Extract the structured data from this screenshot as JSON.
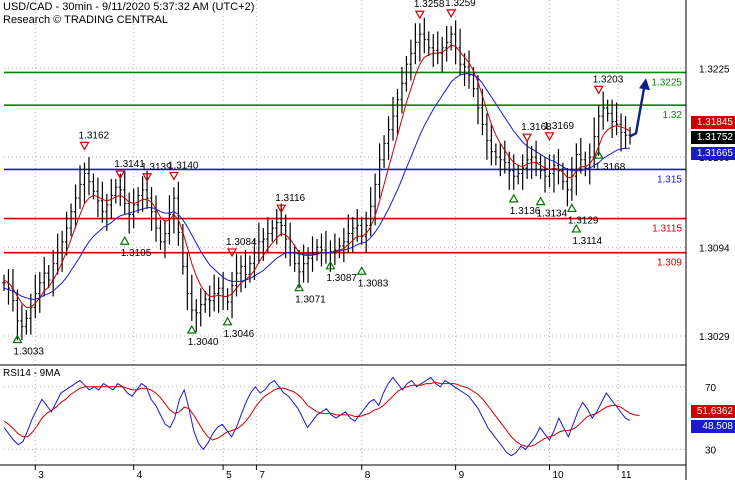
{
  "header": {
    "title": "USD/CAD - 30min - 9/11/2020 5:37:32 AM (UTC+2)",
    "source": "Research © TRADING CENTRAL"
  },
  "rsi_title": "RSI14 - 9MA",
  "colors": {
    "price_bar": "#000000",
    "ma_fast": "#cc0000",
    "ma_slow": "#1a1acc",
    "support": "#cc0000",
    "resistance_green": "#008800",
    "pivot": "#1a1acc",
    "forecast_arrow": "#0a1f8a",
    "up_marker": "#007700",
    "down_marker": "#cc0000",
    "grid": "#b0b0b0"
  },
  "chart_data": [
    {
      "type": "line",
      "title": "USD/CAD - 30min - 9/11/2020 5:37:32 AM (UTC+2)",
      "y_ticks": [
        "1.3225",
        "1.3160",
        "1.3094",
        "1.3029"
      ],
      "ylim": [
        1.301,
        1.3275
      ],
      "x_ticks": [
        "3",
        "4",
        "5",
        "7",
        "8",
        "9",
        "10",
        "11"
      ],
      "levels": [
        {
          "label": "1.3225",
          "value": 1.3222,
          "color": "resistance_green"
        },
        {
          "label": "1.32",
          "value": 1.3198,
          "color": "resistance_green"
        },
        {
          "label": "1.315",
          "value": 1.3151,
          "color": "pivot"
        },
        {
          "label": "1.3115",
          "value": 1.3115,
          "color": "support"
        },
        {
          "label": "1.309",
          "value": 1.309,
          "color": "support"
        }
      ],
      "current_prices": [
        {
          "label": "1.31845",
          "value": 1.31845,
          "color": "#cc0000"
        },
        {
          "label": "1.31752",
          "value": 1.31752,
          "color": "#000000"
        },
        {
          "label": "1.31665",
          "value": 1.31665,
          "color": "#1a1acc"
        }
      ],
      "annotations": [
        {
          "label": "1.3033",
          "value": 1.3033,
          "dir": "low",
          "idx": 3
        },
        {
          "label": "1.3162",
          "value": 1.3162,
          "dir": "high",
          "idx": 18
        },
        {
          "label": "1.3141",
          "value": 1.3141,
          "dir": "high",
          "idx": 26
        },
        {
          "label": "1.3105",
          "value": 1.3105,
          "dir": "low",
          "idx": 27
        },
        {
          "label": "1.3139",
          "value": 1.3139,
          "dir": "high",
          "idx": 32
        },
        {
          "label": "1.3140",
          "value": 1.314,
          "dir": "high",
          "idx": 38
        },
        {
          "label": "1.3040",
          "value": 1.304,
          "dir": "low",
          "idx": 42
        },
        {
          "label": "1.3046",
          "value": 1.3046,
          "dir": "low",
          "idx": 50
        },
        {
          "label": "1.3084",
          "value": 1.3084,
          "dir": "high",
          "idx": 51
        },
        {
          "label": "1.3116",
          "value": 1.3116,
          "dir": "high",
          "idx": 62
        },
        {
          "label": "1.3071",
          "value": 1.3071,
          "dir": "low",
          "idx": 66
        },
        {
          "label": "1.3087",
          "value": 1.3087,
          "dir": "low",
          "idx": 73
        },
        {
          "label": "1.3083",
          "value": 1.3083,
          "dir": "low",
          "idx": 80
        },
        {
          "label": "1.3258",
          "value": 1.3258,
          "dir": "high",
          "idx": 93
        },
        {
          "label": "1.3259",
          "value": 1.3259,
          "dir": "high",
          "idx": 100
        },
        {
          "label": "1.3136",
          "value": 1.3136,
          "dir": "low",
          "idx": 114
        },
        {
          "label": "1.3168",
          "value": 1.3168,
          "dir": "high",
          "idx": 117
        },
        {
          "label": "1.3134",
          "value": 1.3134,
          "dir": "low",
          "idx": 120
        },
        {
          "label": "1.3169",
          "value": 1.3169,
          "dir": "high",
          "idx": 122
        },
        {
          "label": "1.3129",
          "value": 1.3129,
          "dir": "low",
          "idx": 127
        },
        {
          "label": "1.3114",
          "value": 1.3114,
          "dir": "low",
          "idx": 128
        },
        {
          "label": "1.3168",
          "value": 1.3168,
          "dir": "low",
          "idx": 133
        },
        {
          "label": "1.3203",
          "value": 1.3203,
          "dir": "high",
          "idx": 133
        }
      ],
      "series": [
        {
          "name": "USD/CAD",
          "values": [
            1.3068,
            1.3064,
            1.3055,
            1.304,
            1.3036,
            1.3042,
            1.305,
            1.306,
            1.3068,
            1.3075,
            1.307,
            1.3082,
            1.309,
            1.3098,
            1.3108,
            1.312,
            1.313,
            1.314,
            1.3148,
            1.3142,
            1.3135,
            1.3128,
            1.312,
            1.3125,
            1.3132,
            1.3138,
            1.3136,
            1.3126,
            1.3118,
            1.3125,
            1.3132,
            1.3136,
            1.313,
            1.312,
            1.3108,
            1.3098,
            1.3104,
            1.3118,
            1.313,
            1.3105,
            1.308,
            1.306,
            1.3048,
            1.3046,
            1.3052,
            1.3056,
            1.3055,
            1.306,
            1.3064,
            1.3058,
            1.3054,
            1.3066,
            1.3075,
            1.308,
            1.3074,
            1.3082,
            1.309,
            1.3098,
            1.31,
            1.3104,
            1.3108,
            1.3112,
            1.311,
            1.31,
            1.309,
            1.3082,
            1.3076,
            1.3082,
            1.3086,
            1.309,
            1.3094,
            1.3092,
            1.309,
            1.3091,
            1.3092,
            1.3095,
            1.3098,
            1.3104,
            1.3108,
            1.311,
            1.3102,
            1.311,
            1.3124,
            1.314,
            1.3158,
            1.317,
            1.318,
            1.319,
            1.3202,
            1.3214,
            1.3228,
            1.3236,
            1.3244,
            1.325,
            1.3246,
            1.324,
            1.3238,
            1.3236,
            1.324,
            1.3244,
            1.325,
            1.324,
            1.3228,
            1.3226,
            1.322,
            1.321,
            1.3196,
            1.3184,
            1.3172,
            1.3164,
            1.316,
            1.3158,
            1.3156,
            1.315,
            1.3146,
            1.3148,
            1.3152,
            1.3158,
            1.316,
            1.3156,
            1.315,
            1.3146,
            1.3148,
            1.3154,
            1.315,
            1.3142,
            1.3136,
            1.3146,
            1.3162,
            1.3158,
            1.3152,
            1.316,
            1.3175,
            1.319,
            1.3196,
            1.3192,
            1.3186,
            1.3184,
            1.3178,
            1.3176,
            1.31752
          ]
        },
        {
          "name": "MA fast",
          "values": [
            1.307,
            1.3068,
            1.3064,
            1.3058,
            1.3053,
            1.305,
            1.305,
            1.3053,
            1.3057,
            1.3062,
            1.3065,
            1.307,
            1.3076,
            1.3083,
            1.3091,
            1.31,
            1.3109,
            1.3118,
            1.3126,
            1.313,
            1.3132,
            1.3131,
            1.3129,
            1.3128,
            1.3129,
            1.3131,
            1.3132,
            1.313,
            1.3127,
            1.3126,
            1.3127,
            1.3129,
            1.3129,
            1.3127,
            1.3122,
            1.3116,
            1.3113,
            1.3114,
            1.3118,
            1.3114,
            1.3105,
            1.3094,
            1.3082,
            1.3073,
            1.3066,
            1.3061,
            1.3058,
            1.3058,
            1.3059,
            1.3058,
            1.3058,
            1.306,
            1.3064,
            1.3068,
            1.307,
            1.3073,
            1.3077,
            1.3083,
            1.3088,
            1.3093,
            1.3097,
            1.3101,
            1.3104,
            1.3103,
            1.31,
            1.3095,
            1.309,
            1.3088,
            1.3088,
            1.3088,
            1.3089,
            1.309,
            1.309,
            1.309,
            1.3091,
            1.3092,
            1.3093,
            1.3096,
            1.3099,
            1.3102,
            1.3102,
            1.3104,
            1.3109,
            1.3117,
            1.3128,
            1.314,
            1.3152,
            1.3164,
            1.3176,
            1.3188,
            1.32,
            1.321,
            1.322,
            1.3228,
            1.3233,
            1.3235,
            1.3236,
            1.3236,
            1.3237,
            1.3239,
            1.3242,
            1.3241,
            1.3237,
            1.3233,
            1.3229,
            1.3223,
            1.3215,
            1.3205,
            1.3194,
            1.3184,
            1.3176,
            1.317,
            1.3165,
            1.316,
            1.3156,
            1.3154,
            1.3153,
            1.3155,
            1.3156,
            1.3156,
            1.3154,
            1.3152,
            1.3151,
            1.3152,
            1.3151,
            1.3149,
            1.3145,
            1.3145,
            1.315,
            1.3153,
            1.3153,
            1.3155,
            1.316,
            1.3168,
            1.3176,
            1.318,
            1.3182,
            1.3183,
            1.3182,
            1.3181,
            1.3179
          ]
        },
        {
          "name": "MA slow",
          "values": [
            1.3064,
            1.3063,
            1.3062,
            1.306,
            1.3058,
            1.3057,
            1.3056,
            1.3056,
            1.3057,
            1.3059,
            1.306,
            1.3062,
            1.3065,
            1.3068,
            1.3072,
            1.3077,
            1.3082,
            1.3087,
            1.3093,
            1.3098,
            1.3102,
            1.3105,
            1.3108,
            1.311,
            1.3112,
            1.3115,
            1.3117,
            1.3118,
            1.3119,
            1.312,
            1.3121,
            1.3122,
            1.3123,
            1.3123,
            1.3122,
            1.312,
            1.3119,
            1.3119,
            1.312,
            1.3118,
            1.3114,
            1.3109,
            1.3103,
            1.3097,
            1.3091,
            1.3086,
            1.3081,
            1.3078,
            1.3075,
            1.3072,
            1.307,
            1.3069,
            1.3069,
            1.3069,
            1.307,
            1.3071,
            1.3073,
            1.3075,
            1.3077,
            1.308,
            1.3083,
            1.3086,
            1.3088,
            1.309,
            1.309,
            1.309,
            1.3089,
            1.3089,
            1.3089,
            1.3089,
            1.3089,
            1.309,
            1.309,
            1.309,
            1.3091,
            1.3091,
            1.3092,
            1.3093,
            1.3094,
            1.3096,
            1.3097,
            1.3098,
            1.3101,
            1.3105,
            1.311,
            1.3116,
            1.3122,
            1.3129,
            1.3136,
            1.3144,
            1.3152,
            1.316,
            1.3168,
            1.3176,
            1.3183,
            1.3189,
            1.3195,
            1.32,
            1.3205,
            1.321,
            1.3215,
            1.3218,
            1.322,
            1.3221,
            1.3221,
            1.322,
            1.3218,
            1.3214,
            1.3209,
            1.3204,
            1.3199,
            1.3194,
            1.3189,
            1.3184,
            1.3179,
            1.3175,
            1.3171,
            1.3168,
            1.3166,
            1.3164,
            1.3162,
            1.316,
            1.3158,
            1.3157,
            1.3155,
            1.3153,
            1.3151,
            1.315,
            1.315,
            1.315,
            1.3151,
            1.3152,
            1.3154,
            1.3156,
            1.3159,
            1.3161,
            1.3163,
            1.3165,
            1.3166,
            1.31665,
            1.31665
          ]
        }
      ],
      "forecast": {
        "from": 1.31752,
        "to": 1.3225
      }
    },
    {
      "type": "line",
      "title": "RSI14 - 9MA",
      "y_ticks": [
        "70",
        "30"
      ],
      "ylim": [
        20,
        82
      ],
      "current_values": [
        {
          "label": "51.6362",
          "value": 51.6362,
          "color": "#cc0000"
        },
        {
          "label": "48.508",
          "value": 48.508,
          "color": "#1a1acc"
        }
      ],
      "series": [
        {
          "name": "RSI14",
          "values": [
            44,
            40,
            36,
            33,
            35,
            42,
            50,
            56,
            62,
            58,
            54,
            60,
            66,
            68,
            70,
            72,
            74,
            71,
            68,
            70,
            68,
            72,
            70,
            68,
            72,
            70,
            66,
            64,
            68,
            72,
            70,
            62,
            58,
            52,
            46,
            44,
            50,
            62,
            68,
            56,
            42,
            34,
            30,
            34,
            40,
            44,
            46,
            42,
            38,
            44,
            52,
            60,
            66,
            70,
            66,
            68,
            72,
            74,
            70,
            66,
            64,
            60,
            56,
            50,
            44,
            48,
            52,
            54,
            56,
            52,
            50,
            52,
            54,
            50,
            48,
            52,
            56,
            60,
            62,
            58,
            66,
            72,
            76,
            72,
            68,
            72,
            74,
            70,
            72,
            74,
            76,
            72,
            70,
            74,
            72,
            70,
            68,
            66,
            64,
            60,
            56,
            50,
            44,
            40,
            36,
            32,
            28,
            26,
            28,
            32,
            30,
            34,
            38,
            44,
            40,
            36,
            42,
            50,
            44,
            38,
            46,
            54,
            60,
            56,
            50,
            54,
            60,
            66,
            62,
            58,
            54,
            50,
            48.508
          ]
        },
        {
          "name": "9MA",
          "values": [
            48,
            46,
            43,
            40,
            38,
            38,
            41,
            45,
            50,
            53,
            55,
            57,
            60,
            62,
            65,
            67,
            69,
            70,
            70,
            70,
            70,
            70,
            70,
            70,
            70,
            70,
            69,
            68,
            68,
            69,
            69,
            68,
            66,
            63,
            59,
            55,
            53,
            54,
            57,
            56,
            52,
            47,
            42,
            38,
            36,
            37,
            39,
            41,
            42,
            43,
            45,
            48,
            52,
            57,
            61,
            64,
            66,
            68,
            69,
            69,
            68,
            67,
            65,
            62,
            58,
            56,
            54,
            53,
            53,
            53,
            52,
            52,
            52,
            52,
            51,
            51,
            52,
            53,
            55,
            56,
            58,
            61,
            64,
            67,
            69,
            70,
            71,
            71,
            71,
            72,
            72,
            73,
            72,
            72,
            72,
            72,
            71,
            70,
            69,
            67,
            65,
            62,
            58,
            54,
            50,
            46,
            42,
            38,
            35,
            33,
            32,
            32,
            33,
            35,
            37,
            38,
            39,
            41,
            42,
            42,
            43,
            45,
            48,
            51,
            52,
            53,
            55,
            57,
            58,
            58,
            57,
            55,
            53,
            52,
            51.6362
          ]
        }
      ]
    }
  ]
}
